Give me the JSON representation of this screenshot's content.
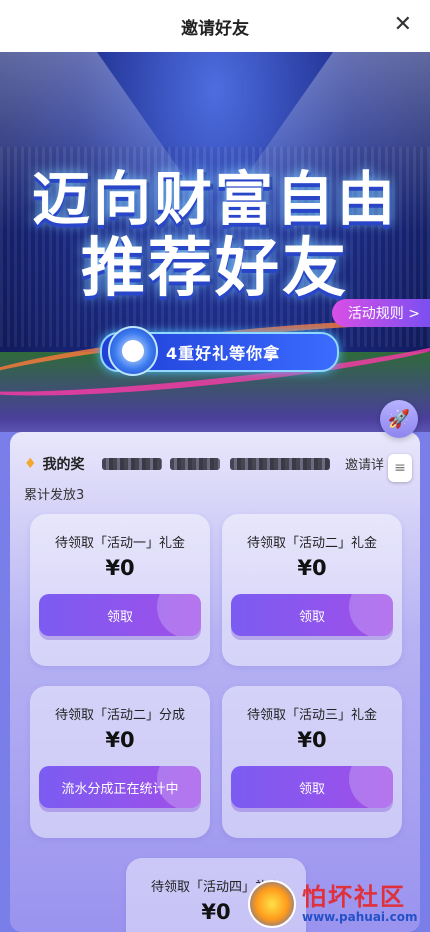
{
  "header": {
    "title": "邀请好友",
    "close_icon": "close-icon"
  },
  "banner": {
    "headline_line1": "迈向财富自由",
    "headline_line2": "推荐好友",
    "rules_button": "活动规则 >",
    "badge_text": "4重好礼等你拿"
  },
  "floating": {
    "rocket_icon": "rocket-icon"
  },
  "panel": {
    "title": "我的奖",
    "invite_detail": "邀请详",
    "total_label": "累计发放3"
  },
  "cards": [
    {
      "label": "待领取「活动一」礼金",
      "amount": "¥0",
      "button": "领取"
    },
    {
      "label": "待领取「活动二」礼金",
      "amount": "¥0",
      "button": "领取"
    },
    {
      "label": "待领取「活动二」分成",
      "amount": "¥0",
      "button": "流水分成正在统计中"
    },
    {
      "label": "待领取「活动三」礼金",
      "amount": "¥0",
      "button": "领取"
    },
    {
      "label": "待领取「活动四」礼金",
      "amount": "¥0"
    }
  ],
  "watermark": {
    "name": "怕坏社区",
    "url": "www.pahuai.com"
  }
}
